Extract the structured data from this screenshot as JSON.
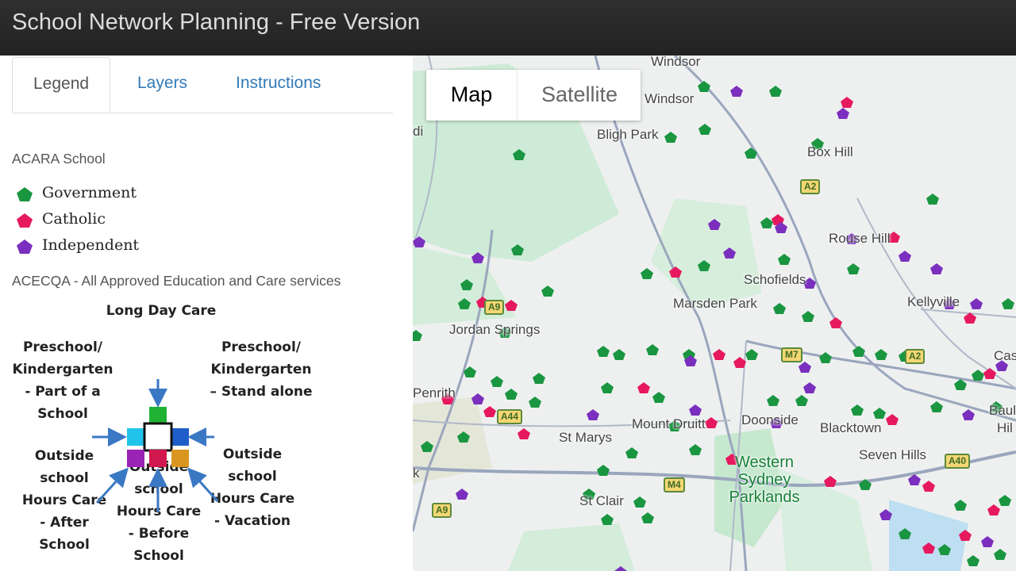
{
  "header": {
    "title": "School Network Planning - Free Version"
  },
  "tabs": [
    {
      "label": "Legend",
      "active": true
    },
    {
      "label": "Layers",
      "active": false
    },
    {
      "label": "Instructions",
      "active": false
    }
  ],
  "legend": {
    "acara_heading": "ACARA School",
    "items": [
      {
        "label": "Government",
        "color": "#1a9641"
      },
      {
        "label": "Catholic",
        "color": "#e6195f"
      },
      {
        "label": "Independent",
        "color": "#7b2fbe"
      }
    ],
    "acecqa_heading": "ACECQA - All Approved Education and Care services",
    "diagram": {
      "long_day_care": "Long Day Care",
      "preschool_part": "Preschool/\nKindergarten\n- Part of a\nSchool",
      "preschool_stand": "Preschool/\nKindergarten\n– Stand alone",
      "oshc_after": "Outside\nschool\nHours Care\n- After\nSchool",
      "oshc_before": "Outside\nschool\nHours Care\n- Before\nSchool",
      "oshc_vacation": "Outside\nschool\nHours Care\n- Vacation",
      "colors": {
        "top": "#1fb233",
        "left": "#21c3ea",
        "right": "#1f5ec9",
        "bottom_left": "#9a24b4",
        "bottom_mid": "#d1184e",
        "bottom_right": "#d99520",
        "arrow": "#3b78c4"
      }
    }
  },
  "map": {
    "toggle": {
      "map_label": "Map",
      "satellite_label": "Satellite"
    },
    "places": {
      "windsor_top": "Windsor",
      "windsor": "Windsor",
      "bligh_park": "Bligh Park",
      "box_hill": "Box Hill",
      "rouse_hill": "Rouse Hill",
      "schofields": "Schofields",
      "marsden_park": "Marsden Park",
      "kellyville": "Kellyville",
      "jordan_springs": "Jordan Springs",
      "penrith": "Penrith",
      "st_marys": "St Marys",
      "mount_druitt": "Mount Druitt",
      "doonside": "Doonside",
      "blacktown": "Blacktown",
      "seven_hills": "Seven Hills",
      "castle": "Cas",
      "baulk": "Baulk",
      "hills": "Hil",
      "st_clair": "St Clair",
      "western_sydney_parklands": "Western\nSydney\nParklands",
      "pk": "k",
      "di": "di"
    },
    "shields": {
      "a2_top": "A2",
      "a2_right": "A2",
      "a9_mid": "A9",
      "m7": "M7",
      "a44": "A44",
      "m4": "M4",
      "a9_bottom": "A9",
      "a40": "A40"
    }
  }
}
